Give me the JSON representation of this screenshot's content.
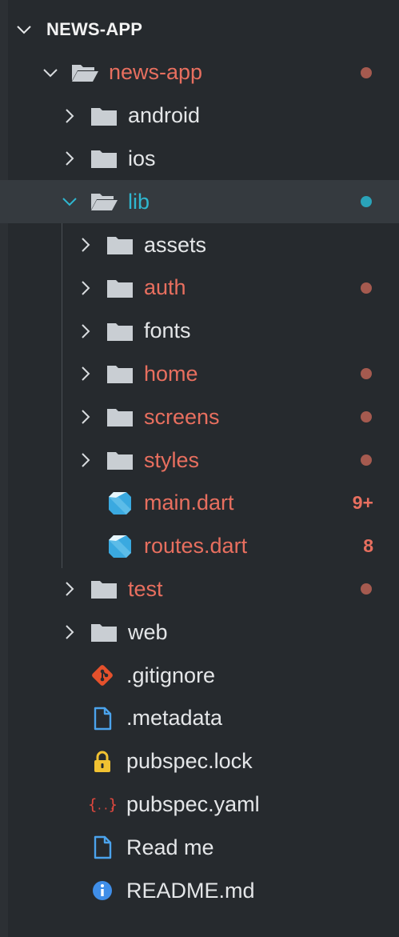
{
  "explorer": {
    "section_title": "NEWS-APP"
  },
  "tree": [
    {
      "label": "news-app",
      "kind": "folder-open",
      "expanded": true,
      "status": "modified",
      "badge": ""
    },
    {
      "label": "android",
      "kind": "folder",
      "expanded": false,
      "status": "none",
      "badge": ""
    },
    {
      "label": "ios",
      "kind": "folder",
      "expanded": false,
      "status": "none",
      "badge": ""
    },
    {
      "label": "lib",
      "kind": "folder-open",
      "expanded": true,
      "status": "selected",
      "badge": ""
    },
    {
      "label": "assets",
      "kind": "folder",
      "expanded": false,
      "status": "none",
      "badge": ""
    },
    {
      "label": "auth",
      "kind": "folder",
      "expanded": false,
      "status": "modified",
      "badge": ""
    },
    {
      "label": "fonts",
      "kind": "folder",
      "expanded": false,
      "status": "none",
      "badge": ""
    },
    {
      "label": "home",
      "kind": "folder",
      "expanded": false,
      "status": "modified",
      "badge": ""
    },
    {
      "label": "screens",
      "kind": "folder",
      "expanded": false,
      "status": "modified",
      "badge": ""
    },
    {
      "label": "styles",
      "kind": "folder",
      "expanded": false,
      "status": "modified",
      "badge": ""
    },
    {
      "label": "main.dart",
      "kind": "dart",
      "expanded": false,
      "status": "error",
      "badge": "9+"
    },
    {
      "label": "routes.dart",
      "kind": "dart",
      "expanded": false,
      "status": "error",
      "badge": "8"
    },
    {
      "label": "test",
      "kind": "folder",
      "expanded": false,
      "status": "modified",
      "badge": ""
    },
    {
      "label": "web",
      "kind": "folder",
      "expanded": false,
      "status": "none",
      "badge": ""
    },
    {
      "label": ".gitignore",
      "kind": "git",
      "expanded": false,
      "status": "none",
      "badge": ""
    },
    {
      "label": ".metadata",
      "kind": "file",
      "expanded": false,
      "status": "none",
      "badge": ""
    },
    {
      "label": "pubspec.lock",
      "kind": "lock",
      "expanded": false,
      "status": "none",
      "badge": ""
    },
    {
      "label": "pubspec.yaml",
      "kind": "yaml",
      "expanded": false,
      "status": "none",
      "badge": ""
    },
    {
      "label": "Read me",
      "kind": "file",
      "expanded": false,
      "status": "none",
      "badge": ""
    },
    {
      "label": "README.md",
      "kind": "info",
      "expanded": false,
      "status": "none",
      "badge": ""
    }
  ],
  "colors": {
    "background": "#262a2e",
    "selection": "#353a3f",
    "modified": "#e86f5f",
    "modified_dot": "#a55a4f",
    "selected_accent": "#2fb7d0",
    "folder": "#c9ced3",
    "dart": "#3aa9e0",
    "git": "#e5512c",
    "lock": "#f1c232",
    "yaml": "#e0483e",
    "info": "#3f8ee8"
  }
}
